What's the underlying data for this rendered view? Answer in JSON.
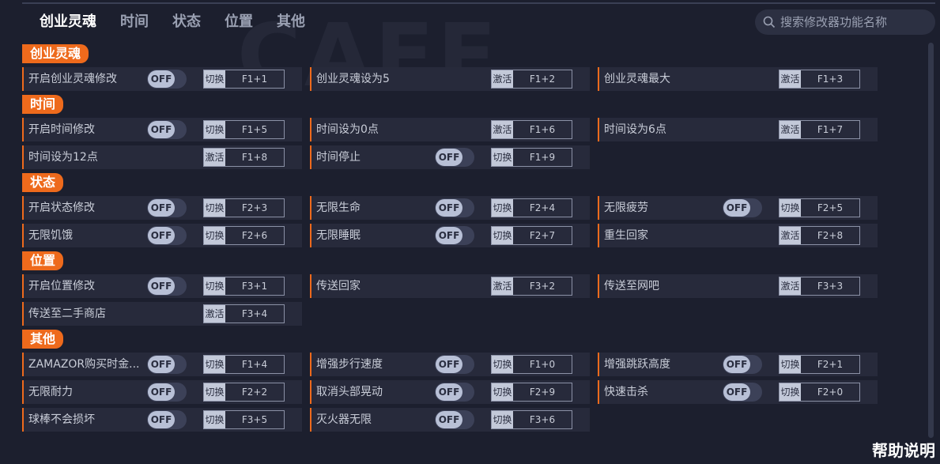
{
  "tabs": [
    "创业灵魂",
    "时间",
    "状态",
    "位置",
    "其他"
  ],
  "search": {
    "placeholder": "搜索修改器功能名称"
  },
  "watermark": "CAFE",
  "help_label": "帮助说明",
  "sections": [
    {
      "title": "创业灵魂",
      "rows": [
        [
          {
            "label": "开启创业灵魂修改",
            "toggle": "OFF",
            "action": "切换",
            "key": "F1+1"
          },
          {
            "label": "创业灵魂设为5",
            "action": "激活",
            "key": "F1+2"
          },
          {
            "label": "创业灵魂最大",
            "action": "激活",
            "key": "F1+3"
          }
        ]
      ]
    },
    {
      "title": "时间",
      "rows": [
        [
          {
            "label": "开启时间修改",
            "toggle": "OFF",
            "action": "切换",
            "key": "F1+5"
          },
          {
            "label": "时间设为0点",
            "action": "激活",
            "key": "F1+6"
          },
          {
            "label": "时间设为6点",
            "action": "激活",
            "key": "F1+7"
          }
        ],
        [
          {
            "label": "时间设为12点",
            "action": "激活",
            "key": "F1+8"
          },
          {
            "label": "时间停止",
            "toggle": "OFF",
            "action": "切换",
            "key": "F1+9"
          }
        ]
      ]
    },
    {
      "title": "状态",
      "rows": [
        [
          {
            "label": "开启状态修改",
            "toggle": "OFF",
            "action": "切换",
            "key": "F2+3"
          },
          {
            "label": "无限生命",
            "toggle": "OFF",
            "action": "切换",
            "key": "F2+4"
          },
          {
            "label": "无限疲劳",
            "toggle": "OFF",
            "action": "切换",
            "key": "F2+5"
          }
        ],
        [
          {
            "label": "无限饥饿",
            "toggle": "OFF",
            "action": "切换",
            "key": "F2+6"
          },
          {
            "label": "无限睡眠",
            "toggle": "OFF",
            "action": "切换",
            "key": "F2+7"
          },
          {
            "label": "重生回家",
            "action": "激活",
            "key": "F2+8"
          }
        ]
      ]
    },
    {
      "title": "位置",
      "rows": [
        [
          {
            "label": "开启位置修改",
            "toggle": "OFF",
            "action": "切换",
            "key": "F3+1"
          },
          {
            "label": "传送回家",
            "action": "激活",
            "key": "F3+2"
          },
          {
            "label": "传送至网吧",
            "action": "激活",
            "key": "F3+3"
          }
        ],
        [
          {
            "label": "传送至二手商店",
            "action": "激活",
            "key": "F3+4"
          }
        ]
      ]
    },
    {
      "title": "其他",
      "rows": [
        [
          {
            "label": "ZAMAZOR购买时金...",
            "toggle": "OFF",
            "action": "切换",
            "key": "F1+4"
          },
          {
            "label": "增强步行速度",
            "toggle": "OFF",
            "action": "切换",
            "key": "F1+0"
          },
          {
            "label": "增强跳跃高度",
            "toggle": "OFF",
            "action": "切换",
            "key": "F2+1"
          }
        ],
        [
          {
            "label": "无限耐力",
            "toggle": "OFF",
            "action": "切换",
            "key": "F2+2"
          },
          {
            "label": "取消头部晃动",
            "toggle": "OFF",
            "action": "切换",
            "key": "F2+9"
          },
          {
            "label": "快速击杀",
            "toggle": "OFF",
            "action": "切换",
            "key": "F2+0"
          }
        ],
        [
          {
            "label": "球棒不会损坏",
            "toggle": "OFF",
            "action": "切换",
            "key": "F3+5"
          },
          {
            "label": "灭火器无限",
            "toggle": "OFF",
            "action": "切换",
            "key": "F3+6"
          }
        ]
      ]
    }
  ]
}
